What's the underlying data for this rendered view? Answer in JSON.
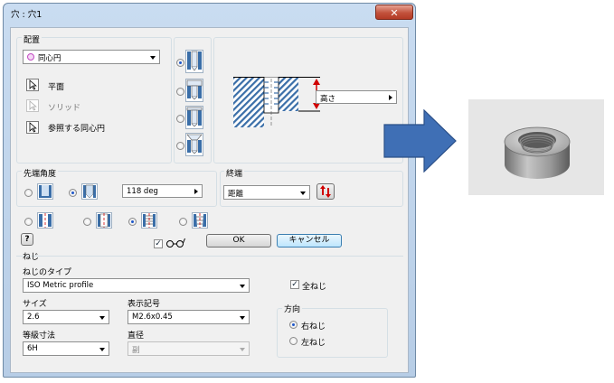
{
  "dialog": {
    "title": "穴 : 穴1",
    "close_label": "✕",
    "placement": {
      "heading": "配置",
      "type_selected": "同心円",
      "plane_label": "平面",
      "solid_label": "ソリッド",
      "concentric_ref_label": "参照する同心円"
    },
    "preview": {
      "height_value": "高さ"
    },
    "drill_point": {
      "heading": "先端角度",
      "angle_value": "118 deg"
    },
    "termination": {
      "heading": "終端",
      "value": "距離"
    },
    "options": {
      "ok_label": "OK",
      "cancel_label": "キャンセル",
      "preview_checked": "✓"
    },
    "threads": {
      "heading": "ねじ",
      "thread_type_label": "ねじのタイプ",
      "thread_type_value": "ISO Metric profile",
      "full_depth_label": "全ねじ",
      "full_depth_checked": "✓",
      "size_label": "サイズ",
      "size_value": "2.6",
      "designation_label": "表示記号",
      "designation_value": "M2.6x0.45",
      "direction_heading": "方向",
      "right_hand_label": "右ねじ",
      "left_hand_label": "左ねじ",
      "class_label": "等級寸法",
      "class_value": "6H",
      "diameter_label": "直径",
      "diameter_value": "副"
    }
  },
  "colors": {
    "accent": "#1e57c9",
    "hatch": "#3a6ea8",
    "arrow": "#3f6fb5",
    "red": "#d00000"
  },
  "icons": {
    "help": "help-icon",
    "flip": "flip-direction-icon",
    "preview": "glasses-icon",
    "arrow": "right-arrow-icon"
  }
}
